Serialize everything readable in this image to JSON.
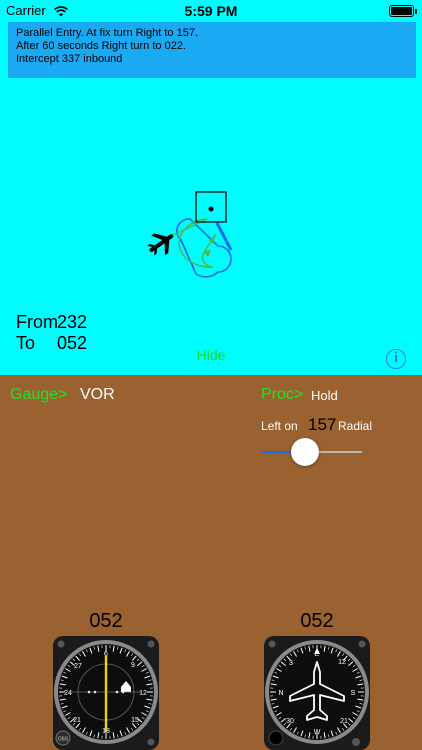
{
  "status_bar": {
    "carrier": "Carrier",
    "time": "5:59 PM",
    "wifi_icon": "wifi-icon",
    "battery_icon": "battery-icon",
    "battery_level": 1.0
  },
  "instructions": {
    "lines": [
      "Parallel Entry. At fix turn Right to 157.",
      "After 60 seconds Right turn to 022.",
      "Intercept 337 inbound"
    ]
  },
  "diagram": {
    "aircraft_icon": "airplane-icon",
    "fix_icon": "fix-square-icon",
    "colors": {
      "background": "#00fcfd",
      "holding_pattern": "#1d6de6",
      "entry_path": "#4ab84a",
      "aircraft": "#000000"
    }
  },
  "readout": {
    "from_label": "From",
    "from_value": "232",
    "to_label": "To",
    "to_value": "052"
  },
  "hide_label": "Hide",
  "info_icon": "info-icon",
  "controls": {
    "gauge_label": "Gauge>",
    "gauge_value": "VOR",
    "proc_label": "Proc>",
    "proc_value": "Hold",
    "left_on_label": "Left on",
    "radial_value": "157",
    "radial_label": "Radial",
    "slider_fraction": 0.44,
    "accent_color": "#22e022"
  },
  "gauges": {
    "vor_value": "052",
    "heading_value": "052",
    "vor_icon": "vor-gauge-icon",
    "heading_icon": "heading-indicator-icon"
  }
}
